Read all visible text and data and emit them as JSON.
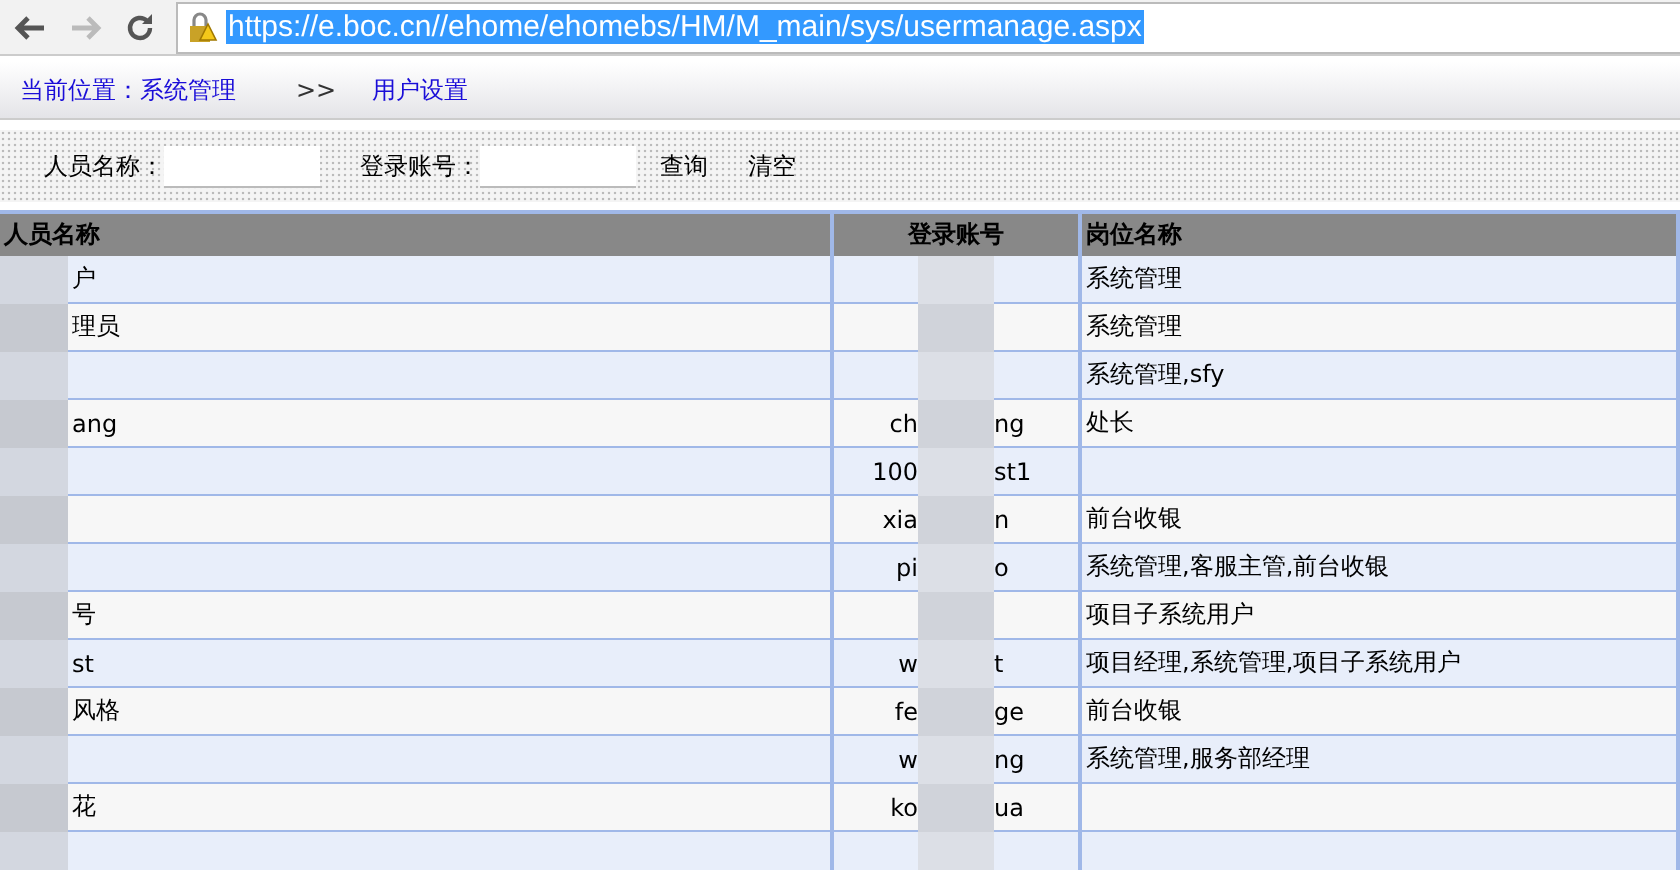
{
  "browser": {
    "url": "https://e.boc.cn//ehome/ehomebs/HM/M_main/sys/usermanage.aspx"
  },
  "breadcrumb": {
    "label": "当前位置：",
    "section": "系统管理",
    "separator": ">>",
    "page": "用户设置"
  },
  "search": {
    "name_label": "人员名称：",
    "account_label": "登录账号：",
    "query_button": "查询",
    "clear_button": "清空"
  },
  "table": {
    "columns": [
      "人员名称",
      "登录账号",
      "岗位名称"
    ],
    "rows": [
      {
        "name": "户",
        "login_start": "",
        "login_end": "",
        "position": "系统管理"
      },
      {
        "name": "理员",
        "login_start": "",
        "login_end": "",
        "position": "系统管理"
      },
      {
        "name": "",
        "login_start": "",
        "login_end": "",
        "position": "系统管理,sfy"
      },
      {
        "name": "ang",
        "login_start": "ch",
        "login_end": "ng",
        "position": "处长"
      },
      {
        "name": "",
        "login_start": "100",
        "login_end": "st1",
        "position": ""
      },
      {
        "name": "",
        "login_start": "xia",
        "login_end": "n",
        "position": "前台收银"
      },
      {
        "name": "",
        "login_start": "pi",
        "login_end": "o",
        "position": "系统管理,客服主管,前台收银"
      },
      {
        "name": "号",
        "login_start": "",
        "login_end": "",
        "position": "项目子系统用户"
      },
      {
        "name": "st",
        "login_start": "w",
        "login_end": "t",
        "position": "项目经理,系统管理,项目子系统用户"
      },
      {
        "name": "风格",
        "login_start": "fe",
        "login_end": "ge",
        "position": "前台收银"
      },
      {
        "name": "",
        "login_start": "w",
        "login_end": "ng",
        "position": "系统管理,服务部经理"
      },
      {
        "name": "花",
        "login_start": "ko",
        "login_end": "ua",
        "position": ""
      },
      {
        "name": "",
        "login_start": "",
        "login_end": "",
        "position": ""
      }
    ]
  }
}
